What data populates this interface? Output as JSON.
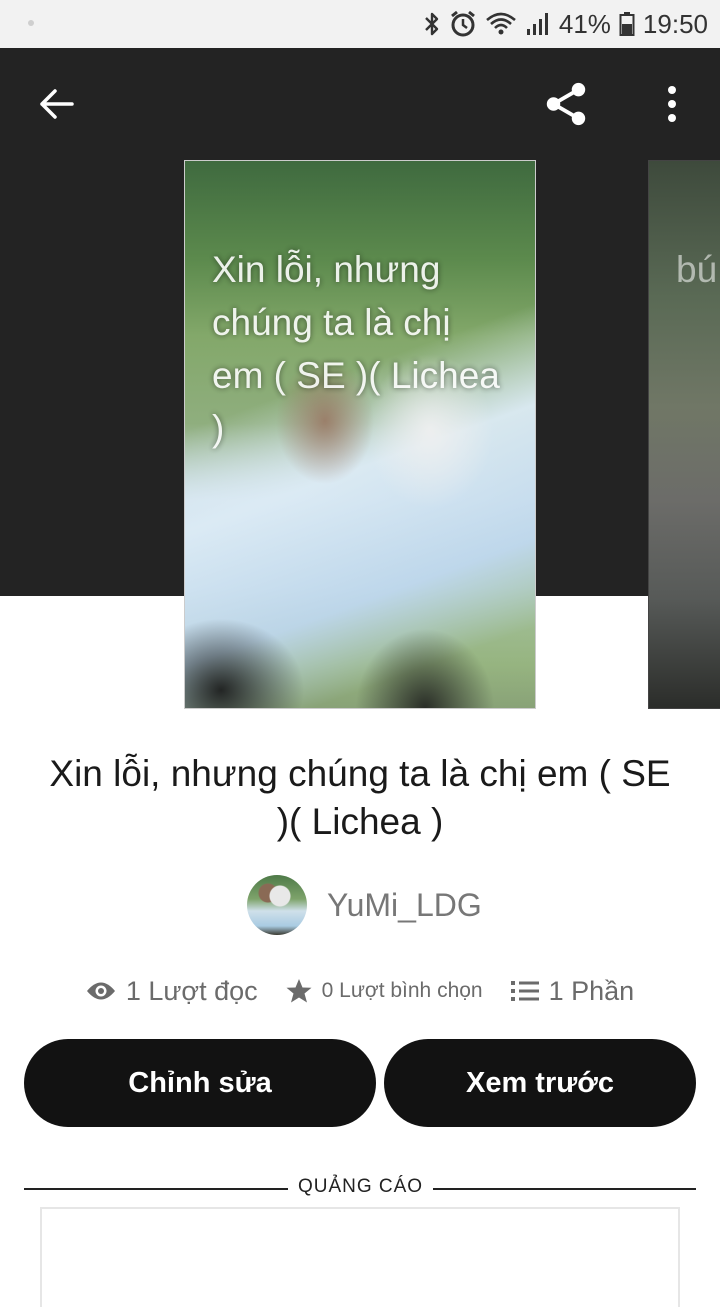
{
  "status_bar": {
    "battery_percent": "41%",
    "time": "19:50",
    "icons": [
      "bluetooth-icon",
      "alarm-icon",
      "wifi-icon",
      "signal-icon",
      "battery-icon"
    ]
  },
  "toolbar": {
    "back_icon": "arrow-left-icon",
    "share_icon": "share-icon",
    "more_icon": "more-vertical-icon"
  },
  "cover": {
    "text": "Xin lỗi, nhưng chúng ta là chị em ( SE )( Lichea )",
    "next_text": "bú dụ"
  },
  "story": {
    "title": "Xin lỗi, nhưng chúng ta là chị em ( SE )( Lichea )",
    "author": "YuMi_LDG"
  },
  "stats": {
    "reads": "1 Lượt đọc",
    "votes": "0 Lượt bình chọn",
    "parts": "1 Phần"
  },
  "actions": {
    "edit_label": "Chỉnh sửa",
    "preview_label": "Xem trước"
  },
  "ad": {
    "label": "QUẢNG CÁO"
  },
  "colors": {
    "hero_background": "#232323",
    "button_background": "#121212",
    "stat_text": "#6b6b6b"
  }
}
